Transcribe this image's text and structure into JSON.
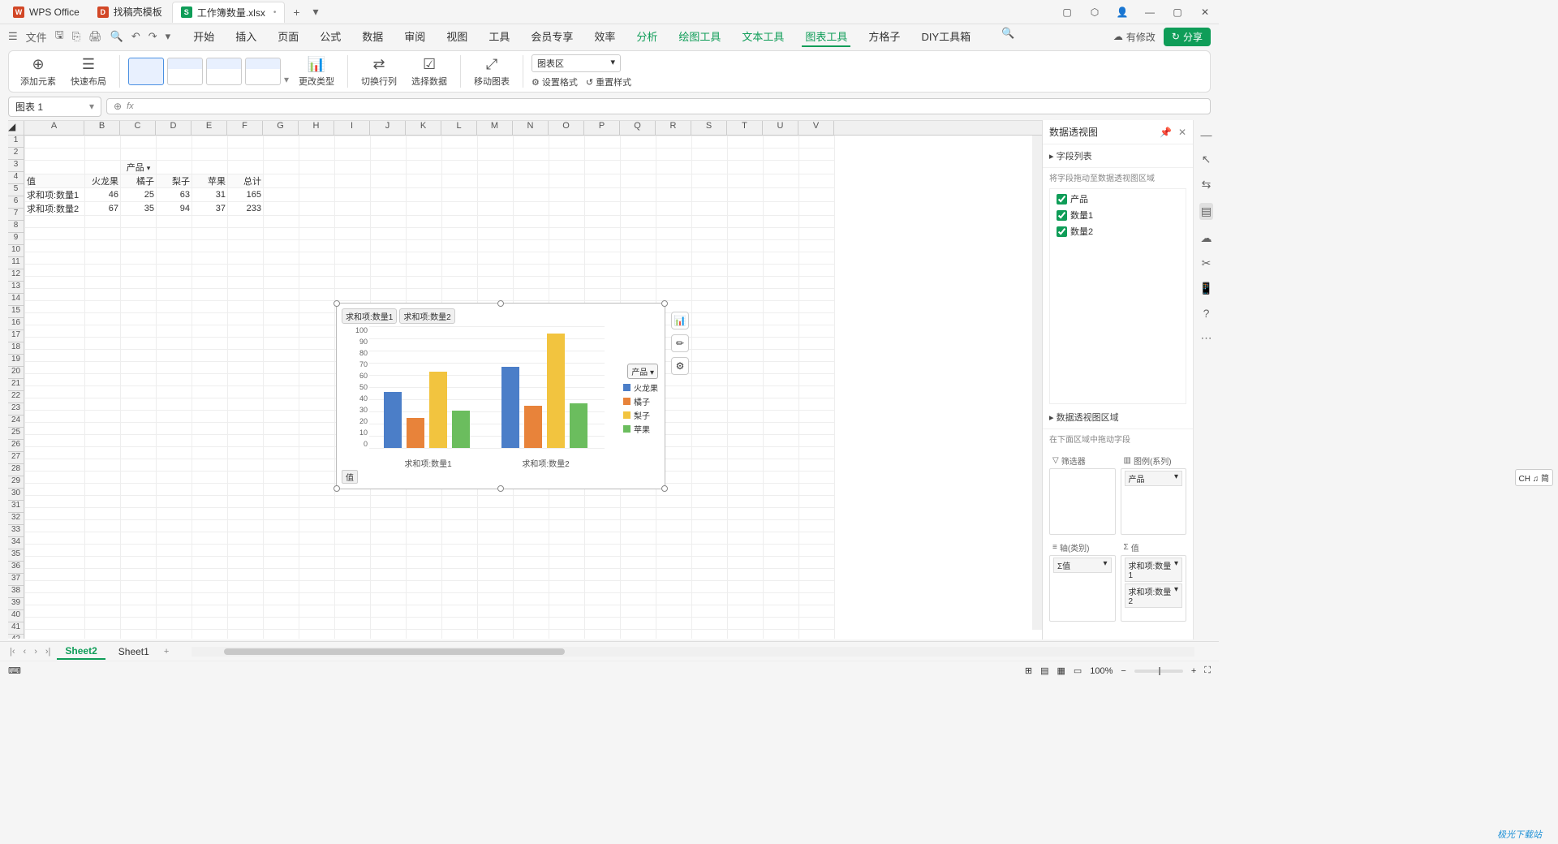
{
  "title_tabs": {
    "wps": "WPS Office",
    "template": "找稿壳模板",
    "doc": "工作簿数量.xlsx"
  },
  "menu": {
    "file": "文件",
    "items": [
      "开始",
      "插入",
      "页面",
      "公式",
      "数据",
      "审阅",
      "视图",
      "工具",
      "会员专享",
      "效率",
      "分析",
      "绘图工具",
      "文本工具",
      "图表工具",
      "方格子",
      "DIY工具箱"
    ],
    "modify": "有修改",
    "share": "分享"
  },
  "ribbon": {
    "add_element": "添加元素",
    "quick_layout": "快速布局",
    "change_type": "更改类型",
    "switch_rc": "切换行列",
    "select_data": "选择数据",
    "move_chart": "移动图表",
    "chart_area": "图表区",
    "set_format": "设置格式",
    "reset_style": "重置样式"
  },
  "namebox": "图表 1",
  "columns": [
    "A",
    "B",
    "C",
    "D",
    "E",
    "F",
    "G",
    "H",
    "I",
    "J",
    "K",
    "L",
    "M",
    "N",
    "O",
    "P",
    "Q",
    "R",
    "S",
    "T",
    "U",
    "V"
  ],
  "table": {
    "header_product": "产品",
    "header_value": "值",
    "cats": [
      "火龙果",
      "橘子",
      "梨子",
      "苹果",
      "总计"
    ],
    "rows": [
      {
        "label": "求和项:数量1",
        "vals": [
          46,
          25,
          63,
          31,
          165
        ]
      },
      {
        "label": "求和项:数量2",
        "vals": [
          67,
          35,
          94,
          37,
          233
        ]
      }
    ]
  },
  "chart_data": {
    "type": "bar",
    "series_buttons": [
      "求和项:数量1",
      "求和项:数量2"
    ],
    "categories": [
      "求和项:数量1",
      "求和项:数量2"
    ],
    "legend_dropdown": "产品",
    "series": [
      {
        "name": "火龙果",
        "color": "#4b7ec8",
        "values": [
          46,
          67
        ]
      },
      {
        "name": "橘子",
        "color": "#e8833a",
        "values": [
          25,
          35
        ]
      },
      {
        "name": "梨子",
        "color": "#f2c43f",
        "values": [
          63,
          94
        ]
      },
      {
        "name": "苹果",
        "color": "#6bbd5e",
        "values": [
          31,
          37
        ]
      }
    ],
    "ylim": [
      0,
      100
    ],
    "yticks": [
      0,
      10,
      20,
      30,
      40,
      50,
      60,
      70,
      80,
      90,
      100
    ],
    "value_pill": "值"
  },
  "side_panel": {
    "title": "数据透视图",
    "field_list_title": "字段列表",
    "drag_hint": "将字段拖动至数据透视图区域",
    "fields": [
      "产品",
      "数量1",
      "数量2"
    ],
    "area_title": "数据透视图区域",
    "area_hint": "在下面区域中拖动字段",
    "filter": "筛选器",
    "legend": "图例(系列)",
    "legend_item": "产品",
    "axis": "轴(类别)",
    "axis_item": "Σ值",
    "values_label": "值",
    "values_items": [
      "求和项:数量1",
      "求和项:数量2"
    ]
  },
  "sheets": {
    "active": "Sheet2",
    "other": "Sheet1"
  },
  "status": {
    "zoom": "100%"
  },
  "ime": "CH ♫ 简",
  "watermark": "极光下载站"
}
